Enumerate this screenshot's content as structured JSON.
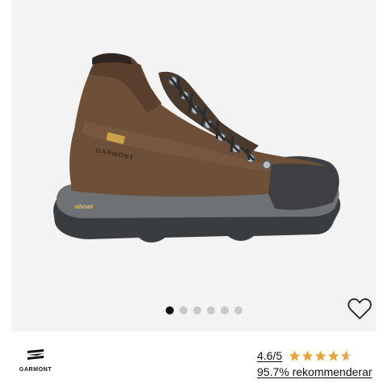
{
  "product": {
    "image_alt": "GARMONT hiking boot",
    "gallery": {
      "dot_count": 6,
      "active_index": 0
    }
  },
  "brand": {
    "name": "GARMONT"
  },
  "rating": {
    "score_text": "4.6/5",
    "value": 4.6,
    "max": 5,
    "star_color": "#e8a33a",
    "star_empty_color": "#d8d8d8"
  },
  "recommend_text": "95.7% rekommenderar",
  "icons": {
    "wishlist": "heart-outline-icon",
    "brand_mark": "garmont-logo-icon",
    "star": "star-icon"
  }
}
